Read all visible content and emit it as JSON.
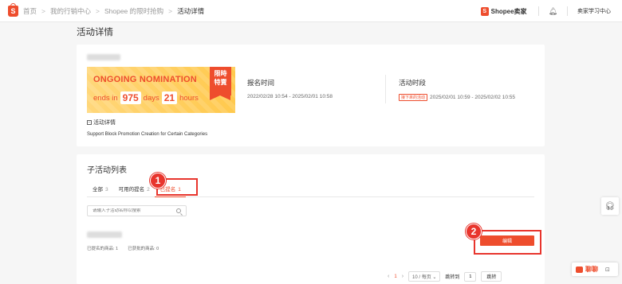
{
  "breadcrumb": {
    "items": [
      "首页",
      "我的行销中心",
      "Shopee 的限时抢购"
    ],
    "current": "活动详情",
    "separator": ">"
  },
  "header": {
    "brand": "Shopee卖家",
    "user_label": "卖家学习中心"
  },
  "page_title": "活动详情",
  "banner": {
    "headline": "ONGOING NOMINATION",
    "ends_in": "ends in",
    "days_value": "975",
    "days_label": "days",
    "hours_value": "21",
    "hours_label": "hours",
    "ribbon_line1": "限時",
    "ribbon_line2": "特賣"
  },
  "registration": {
    "label": "报名时间",
    "value": "2022/02/28 10:54 - 2025/02/01 10:58"
  },
  "activity_period": {
    "label": "活动时段",
    "tag": "接下來的活动",
    "value": "2025/02/01 10:59 - 2025/02/02 10:55"
  },
  "details": {
    "toggle_label": "活动详情",
    "toggle_icon": "minus",
    "text": "Support Block Promotion Creation for Certain Categories"
  },
  "sub_activities": {
    "title": "子活动列表",
    "tabs": [
      {
        "label": "全部",
        "count": "3"
      },
      {
        "label": "可用的提名",
        "count": "2"
      },
      {
        "label": "已提名",
        "count": "1"
      }
    ],
    "search_placeholder": "请输入子活动名称以搜索",
    "row": {
      "stat1": "已提名的商品: 1",
      "stat2": "已获批的商品: 0",
      "edit_label": "编辑"
    }
  },
  "annotations": {
    "badge1": "1",
    "badge2": "2",
    "color": "#e8352d"
  },
  "pagination": {
    "prev": "‹",
    "page": "1",
    "next": "›",
    "page_size": "10 / 每页 ⌄",
    "goto_label": "跳转到",
    "goto_value": "1",
    "goto_button": "跳转"
  },
  "chat": {
    "label": "聊聊"
  },
  "colors": {
    "accent": "#ee4d2d",
    "banner_bg": "#ffd77a"
  }
}
